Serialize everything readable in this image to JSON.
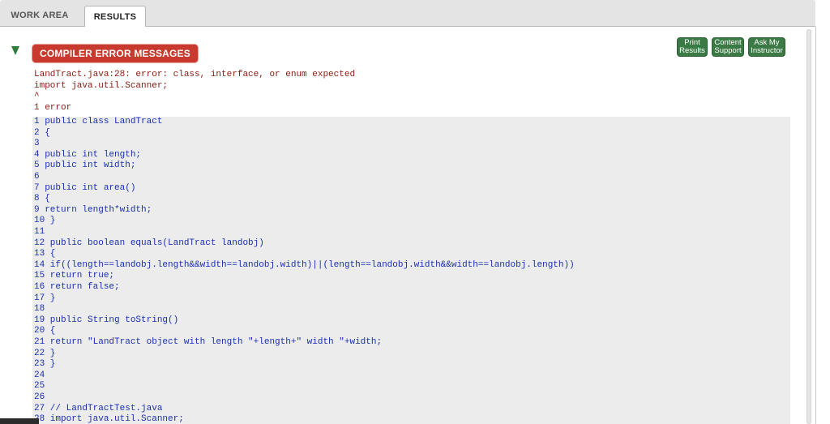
{
  "tabs": {
    "work_area": "WORK AREA",
    "results": "RESULTS"
  },
  "header": {
    "title": "COMPILER ERROR MESSAGES"
  },
  "buttons": {
    "print": "Print\nResults",
    "support": "Content\nSupport",
    "ask": "Ask My\nInstructor"
  },
  "messages": [
    "LandTract.java:28: error: class, interface, or enum expected",
    "import java.util.Scanner;",
    "^",
    "1 error"
  ],
  "code": [
    "1 public class LandTract",
    "2 {",
    "3",
    "4 public int length;",
    "5 public int width;",
    "6",
    "7 public int area()",
    "8 {",
    "9 return length*width;",
    "10 }",
    "11",
    "12 public boolean equals(LandTract landobj)",
    "13 {",
    "14 if((length==landobj.length&&width==landobj.width)||(length==landobj.width&&width==landobj.length))",
    "15 return true;",
    "16 return false;",
    "17 }",
    "18",
    "19 public String toString()",
    "20 {",
    "21 return \"LandTract object with length \"+length+\" width \"+width;",
    "22 }",
    "23 }",
    "24",
    "25",
    "26",
    "27 // LandTractTest.java",
    "28 import java.util.Scanner;"
  ],
  "colors": {
    "error_red": "#c8392e",
    "button_green": "#3b7a45",
    "code_blue": "#1a2fb4",
    "message_red": "#8b1a10"
  }
}
